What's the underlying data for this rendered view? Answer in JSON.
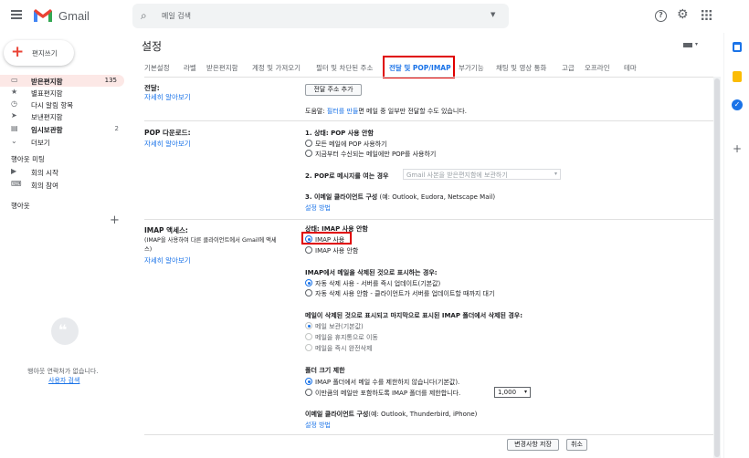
{
  "app": {
    "name": "Gmail"
  },
  "search": {
    "placeholder": "메일 검색"
  },
  "compose": {
    "label": "편지쓰기"
  },
  "sidebar": {
    "items": [
      {
        "label": "받은편지함",
        "count": "135",
        "icon": "inbox-icon"
      },
      {
        "label": "별표편지함",
        "count": "",
        "icon": "star-icon"
      },
      {
        "label": "다시 알림 항목",
        "count": "",
        "icon": "clock-icon"
      },
      {
        "label": "보낸편지함",
        "count": "",
        "icon": "send-icon"
      },
      {
        "label": "임시보관함",
        "count": "2",
        "icon": "draft-icon"
      },
      {
        "label": "더보기",
        "count": "",
        "icon": "chevron-down-icon"
      }
    ],
    "meet_title": "행아웃 미팅",
    "meet_items": [
      {
        "label": "회의 시작"
      },
      {
        "label": "회의 참여"
      }
    ],
    "hangouts_title": "행아웃",
    "no_contacts": "행아웃 연락처가 없습니다.",
    "find_user": "사용자 검색"
  },
  "settings": {
    "title": "설정",
    "tabs": [
      "기본설정",
      "라벨",
      "받은편지함",
      "계정 및 가져오기",
      "필터 및 차단된 주소",
      "전달 및 POP/IMAP",
      "부가기능",
      "채팅 및 영상 통화",
      "고급",
      "오프라인",
      "테마"
    ],
    "forwarding": {
      "label": "전달:",
      "learn_more": "자세히 알아보기",
      "add_button": "전달 주소 추가",
      "tip_prefix": "도움말: ",
      "tip_link": "필터를 만들",
      "tip_suffix": "면 메일 중 일부만 전달할 수도 있습니다."
    },
    "pop": {
      "label": "POP 다운로드:",
      "learn_more": "자세히 알아보기",
      "status": "1. 상태: POP 사용 안함",
      "opt_all": "모든 메일에 POP 사용하기",
      "opt_now": "지금부터 수신되는 메일에만 POP를 사용하기",
      "when_label": "2. POP로 메시지를 여는 경우",
      "when_select": "Gmail 사본을 받은편지함에 보관하기",
      "client_label": "3. 이메일 클라이언트 구성",
      "client_hint": " (예: Outlook, Eudora, Netscape Mail)",
      "setup": "설정 방법"
    },
    "imap": {
      "label": "IMAP 액세스:",
      "desc_line1": "(IMAP을 사용하여 다른 클라이언트에서 Gmail에 액세",
      "desc_line2": "스)",
      "learn_more": "자세히 알아보기",
      "status": "상태: IMAP 사용 안함",
      "enable": "IMAP 사용",
      "disable": "IMAP 사용 안함",
      "delete_title": "IMAP에서 메일을 삭제된 것으로 표시하는 경우:",
      "auto_on": "자동 삭제 사용 - 서버를 즉시 업데이트(기본값)",
      "auto_off": "자동 삭제 사용 안함 - 클라이언트가 서버를 업데이트할 때까지 대기",
      "expunge_title": "메일이 삭제된 것으로 표시되고 마지막으로 표시된 IMAP 폴더에서 삭제된 경우:",
      "archive": "메일 보관(기본값)",
      "trash": "메일을 휴지통으로 이동",
      "delete_forever": "메일을 즉시 완전삭제",
      "folder_title": "폴더 크기 제한",
      "no_limit": "IMAP 폴더에서 메일 수를 제한하지 않습니다(기본값).",
      "limit_prefix": "이만큼의 메일만 포함하도록 IMAP 폴더를 제한합니다.",
      "limit_value": "1,000",
      "client_label": "이메일 클라이언트 구성",
      "client_hint": "(예: Outlook, Thunderbird, iPhone)",
      "setup": "설정 방법"
    },
    "save": "변경사항 저장",
    "cancel": "취소"
  },
  "colors": {
    "accent": "#1a73e8",
    "highlight": "#e00000",
    "gmail_red": "#ea4335"
  }
}
